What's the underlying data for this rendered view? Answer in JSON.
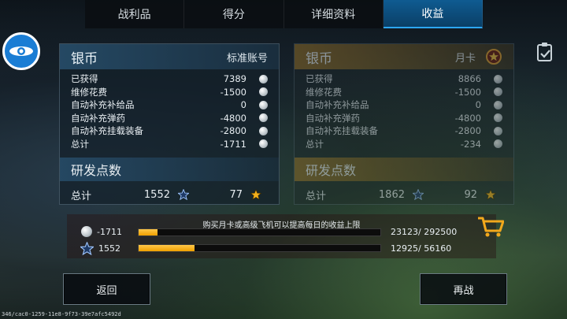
{
  "tabs": [
    {
      "label": "战利品"
    },
    {
      "label": "得分"
    },
    {
      "label": "详细资料"
    },
    {
      "label": "收益",
      "active": true
    }
  ],
  "standard": {
    "title": "银币",
    "account": "标准账号",
    "rows": [
      {
        "label": "已获得",
        "value": "7389"
      },
      {
        "label": "维修花费",
        "value": "-1500"
      },
      {
        "label": "自动补充补给品",
        "value": "0"
      },
      {
        "label": "自动补充弹药",
        "value": "-4800"
      },
      {
        "label": "自动补充挂载装备",
        "value": "-2800"
      },
      {
        "label": "总计",
        "value": "-1711"
      }
    ],
    "research_title": "研发点数",
    "total_label": "总计",
    "research_blue": "1552",
    "research_gold": "77"
  },
  "monthly": {
    "title": "银币",
    "account": "月卡",
    "rows": [
      {
        "label": "已获得",
        "value": "8866"
      },
      {
        "label": "维修花费",
        "value": "-1500"
      },
      {
        "label": "自动补充补给品",
        "value": "0"
      },
      {
        "label": "自动补充弹药",
        "value": "-4800"
      },
      {
        "label": "自动补充挂载装备",
        "value": "-2800"
      },
      {
        "label": "总计",
        "value": "-234"
      }
    ],
    "research_title": "研发点数",
    "total_label": "总计",
    "research_blue": "1862",
    "research_gold": "92"
  },
  "income": {
    "hint": "购买月卡或高级飞机可以提高每日的收益上限",
    "silver": {
      "value": "-1711",
      "progress_text": "23123/ 292500",
      "fraction": 0.079
    },
    "research": {
      "value": "1552",
      "progress_text": "12925/ 56160",
      "fraction": 0.23
    }
  },
  "buttons": {
    "back": "返回",
    "again": "再战"
  },
  "version": "346/cac0-1259-11e8-9f73-39e7afc5492d",
  "colors": {
    "accent": "#1a7dd4",
    "tab_active": "#0f5b91",
    "gold": "#f0a000"
  },
  "icons": [
    "logo-icon",
    "clipboard-icon",
    "silver-coin-icon",
    "blue-star-icon",
    "gold-star-icon",
    "cart-icon",
    "rank-badge-icon"
  ]
}
